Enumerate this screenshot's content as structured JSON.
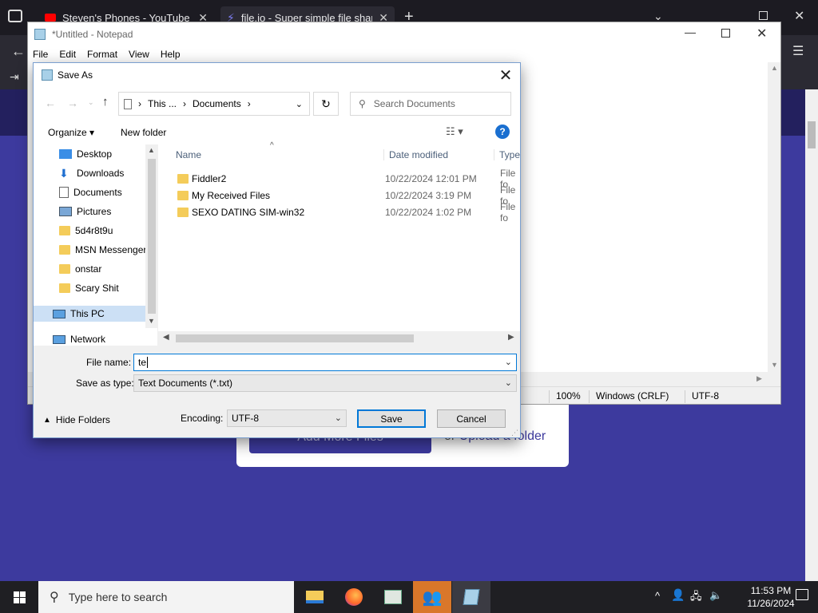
{
  "browser": {
    "tabs": [
      {
        "title": "Steven's Phones - YouTube"
      },
      {
        "title": "file.io - Super simple file sharing"
      }
    ],
    "page": {
      "add_more_label": "Add More Files",
      "or_label": "or",
      "upload_folder_label": "Upload a folder"
    }
  },
  "notepad": {
    "title": "*Untitled - Notepad",
    "menu": [
      "File",
      "Edit",
      "Format",
      "View",
      "Help"
    ],
    "status": {
      "zoom": "100%",
      "line_ending": "Windows (CRLF)",
      "encoding": "UTF-8"
    }
  },
  "dialog": {
    "title": "Save As",
    "breadcrumb": [
      "This ...",
      "Documents"
    ],
    "search_placeholder": "Search Documents",
    "organize_label": "Organize",
    "new_folder_label": "New folder",
    "nav": [
      {
        "label": "Desktop",
        "icon": "desktop-icon",
        "pinned": true
      },
      {
        "label": "Downloads",
        "icon": "downloads-icon",
        "pinned": true
      },
      {
        "label": "Documents",
        "icon": "documents-icon",
        "pinned": true
      },
      {
        "label": "Pictures",
        "icon": "pictures-icon",
        "pinned": true
      },
      {
        "label": "5d4r8t9u",
        "icon": "folder-icon"
      },
      {
        "label": "MSN Messenger",
        "icon": "folder-icon"
      },
      {
        "label": "onstar",
        "icon": "folder-icon"
      },
      {
        "label": "Scary Shit",
        "icon": "folder-icon"
      },
      {
        "label": "This PC",
        "icon": "computer-icon",
        "selected": true
      },
      {
        "label": "Network",
        "icon": "network-icon"
      }
    ],
    "columns": {
      "name": "Name",
      "date": "Date modified",
      "type": "Type"
    },
    "files": [
      {
        "name": "Fiddler2",
        "date": "10/22/2024 12:01 PM",
        "type": "File fo"
      },
      {
        "name": "My Received Files",
        "date": "10/22/2024 3:19 PM",
        "type": "File fo"
      },
      {
        "name": "SEXO DATING SIM-win32",
        "date": "10/22/2024 1:02 PM",
        "type": "File fo"
      }
    ],
    "file_name_label": "File name:",
    "file_name_value": "te",
    "save_type_label": "Save as type:",
    "save_type_value": "Text Documents (*.txt)",
    "hide_folders_label": "Hide Folders",
    "encoding_label": "Encoding:",
    "encoding_value": "UTF-8",
    "save_label": "Save",
    "cancel_label": "Cancel"
  },
  "taskbar": {
    "search_placeholder": "Type here to search",
    "time": "11:53 PM",
    "date": "11/26/2024"
  },
  "colors": {
    "accent": "#0078d7",
    "site_bg": "#3d3a9e",
    "taskbar": "#1f1f23"
  }
}
